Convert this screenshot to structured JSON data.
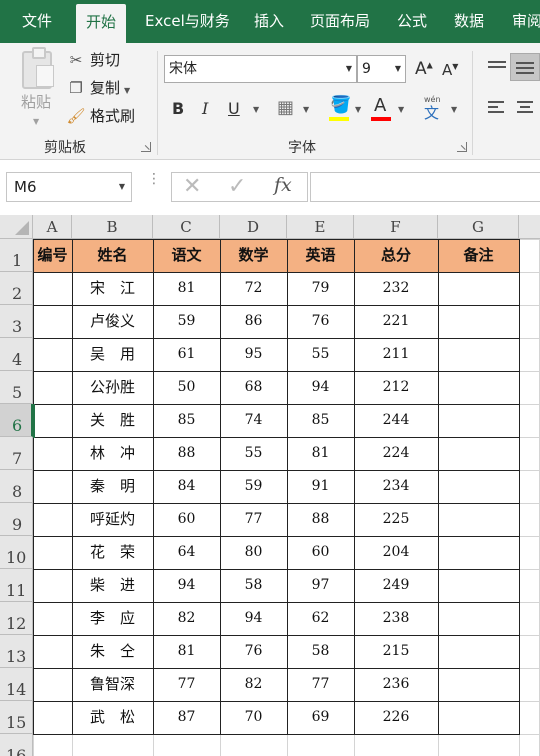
{
  "tabs": [
    {
      "label": "文件",
      "active": false
    },
    {
      "label": "开始",
      "active": true
    },
    {
      "label": "Excel与财务",
      "active": false
    },
    {
      "label": "插入",
      "active": false
    },
    {
      "label": "页面布局",
      "active": false
    },
    {
      "label": "公式",
      "active": false
    },
    {
      "label": "数据",
      "active": false
    },
    {
      "label": "审阅",
      "active": false
    }
  ],
  "clipboard": {
    "paste_label": "粘贴",
    "cut_label": "剪切",
    "copy_label": "复制",
    "format_painter_label": "格式刷",
    "group_label": "剪贴板"
  },
  "font": {
    "font_name": "宋体",
    "font_size": "9",
    "bold_label": "B",
    "italic_label": "I",
    "underline_label": "U",
    "font_color_label": "A",
    "grow_label": "A",
    "shrink_label": "A",
    "pinyin_label": "wén",
    "pinyin_char": "文",
    "group_label": "字体",
    "highlight_color": "#FFFF00",
    "font_color": "#FF0000"
  },
  "formula_bar": {
    "name_box": "M6",
    "cancel_icon": "✕",
    "enter_icon": "✓",
    "fx_label": "fx",
    "formula": ""
  },
  "sheet": {
    "columns": [
      "A",
      "B",
      "C",
      "D",
      "E",
      "F",
      "G"
    ],
    "rows": [
      "1",
      "2",
      "3",
      "4",
      "5",
      "6",
      "7",
      "8",
      "9",
      "10",
      "11",
      "12",
      "13",
      "14",
      "15",
      "16"
    ],
    "active_row": "6",
    "header_fill": "#F4B183",
    "headers": [
      "编号",
      "姓名",
      "语文",
      "数学",
      "英语",
      "总分",
      "备注"
    ],
    "data": [
      [
        "",
        "宋　江",
        "81",
        "72",
        "79",
        "232",
        ""
      ],
      [
        "",
        "卢俊义",
        "59",
        "86",
        "76",
        "221",
        ""
      ],
      [
        "",
        "吴　用",
        "61",
        "95",
        "55",
        "211",
        ""
      ],
      [
        "",
        "公孙胜",
        "50",
        "68",
        "94",
        "212",
        ""
      ],
      [
        "",
        "关　胜",
        "85",
        "74",
        "85",
        "244",
        ""
      ],
      [
        "",
        "林　冲",
        "88",
        "55",
        "81",
        "224",
        ""
      ],
      [
        "",
        "秦　明",
        "84",
        "59",
        "91",
        "234",
        ""
      ],
      [
        "",
        "呼延灼",
        "60",
        "77",
        "88",
        "225",
        ""
      ],
      [
        "",
        "花　荣",
        "64",
        "80",
        "60",
        "204",
        ""
      ],
      [
        "",
        "柴　进",
        "94",
        "58",
        "97",
        "249",
        ""
      ],
      [
        "",
        "李　应",
        "82",
        "94",
        "62",
        "238",
        ""
      ],
      [
        "",
        "朱　仝",
        "81",
        "76",
        "58",
        "215",
        ""
      ],
      [
        "",
        "鲁智深",
        "77",
        "82",
        "77",
        "236",
        ""
      ],
      [
        "",
        "武　松",
        "87",
        "70",
        "69",
        "226",
        ""
      ]
    ]
  }
}
